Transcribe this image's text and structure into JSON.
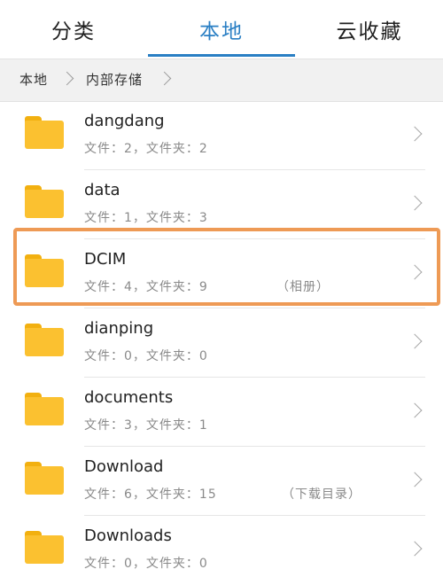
{
  "tabs": [
    {
      "label": "分类"
    },
    {
      "label": "本地",
      "active": true
    },
    {
      "label": "云收藏"
    }
  ],
  "breadcrumb": {
    "items": [
      "本地",
      "内部存储"
    ]
  },
  "colors": {
    "accent": "#2a7fc4",
    "folder": "#fbc130",
    "highlight": "#ee9a55"
  },
  "folders": [
    {
      "name": "dangdang",
      "meta": "文件：2，文件夹：2",
      "tag": ""
    },
    {
      "name": "data",
      "meta": "文件：1，文件夹：3",
      "tag": ""
    },
    {
      "name": "DCIM",
      "meta": "文件：4，文件夹：9",
      "tag": "（相册）",
      "highlighted": true
    },
    {
      "name": "dianping",
      "meta": "文件：0，文件夹：0",
      "tag": ""
    },
    {
      "name": "documents",
      "meta": "文件：3，文件夹：1",
      "tag": ""
    },
    {
      "name": "Download",
      "meta": "文件：6，文件夹：15",
      "tag": "（下载目录）"
    },
    {
      "name": "Downloads",
      "meta": "文件：0，文件夹：0",
      "tag": ""
    }
  ]
}
